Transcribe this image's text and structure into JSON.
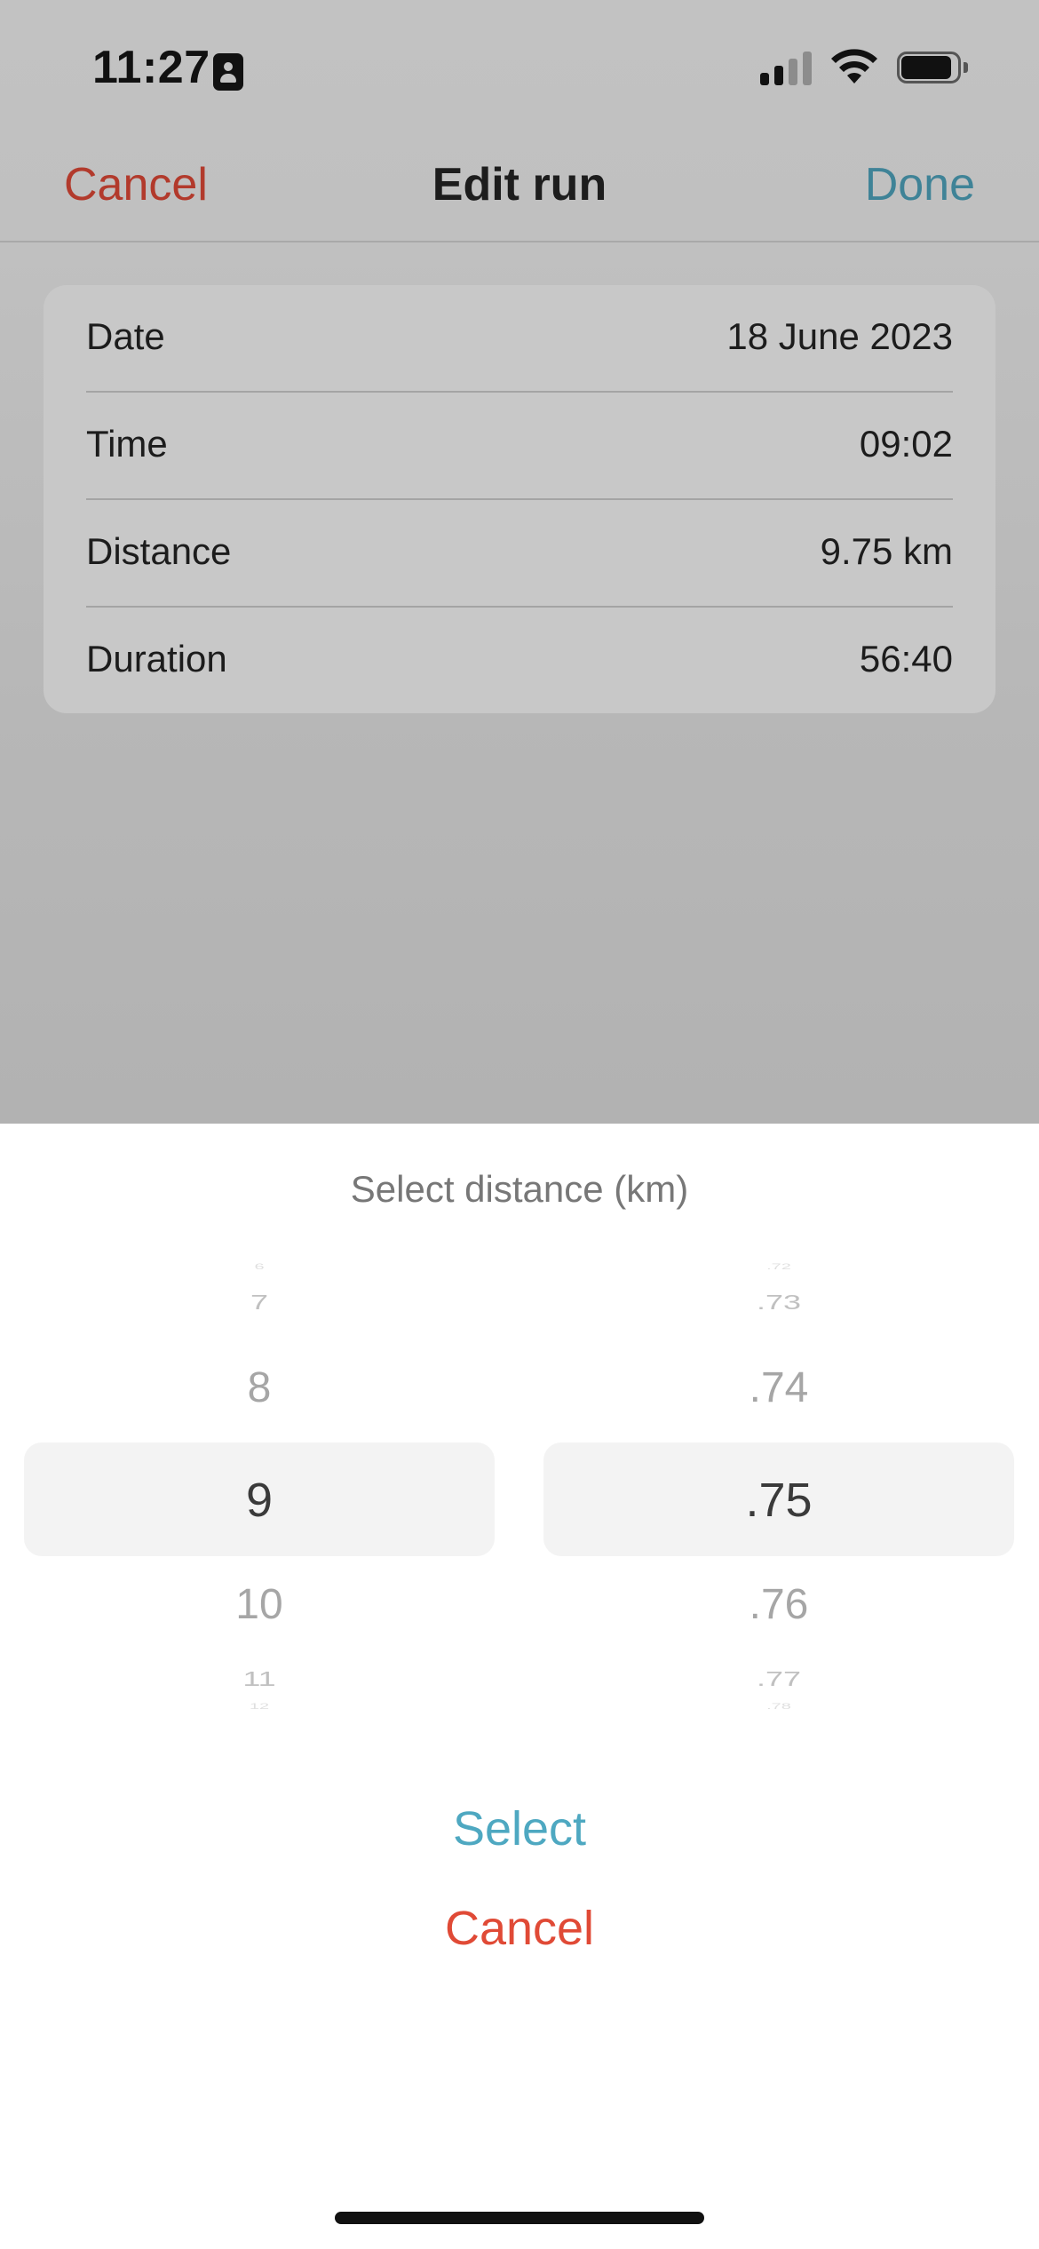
{
  "status_bar": {
    "time": "11:27"
  },
  "nav": {
    "cancel_label": "Cancel",
    "title": "Edit run",
    "done_label": "Done"
  },
  "details": [
    {
      "label": "Date",
      "value": "18 June 2023"
    },
    {
      "label": "Time",
      "value": "09:02"
    },
    {
      "label": "Distance",
      "value": "9.75 km"
    },
    {
      "label": "Duration",
      "value": "56:40"
    }
  ],
  "picker": {
    "title": "Select distance (km)",
    "whole_column": [
      "6",
      "7",
      "8",
      "9",
      "10",
      "11",
      "12"
    ],
    "decimal_column": [
      ".72",
      ".73",
      ".74",
      ".75",
      ".76",
      ".77",
      ".78"
    ],
    "selected_whole": "9",
    "selected_decimal": ".75",
    "select_label": "Select",
    "cancel_label": "Cancel"
  },
  "colors": {
    "cancel_red": "#b23a2c",
    "done_blue": "#3f8397",
    "select_blue": "#4ea8c1",
    "sheet_cancel_red": "#e04a36"
  }
}
